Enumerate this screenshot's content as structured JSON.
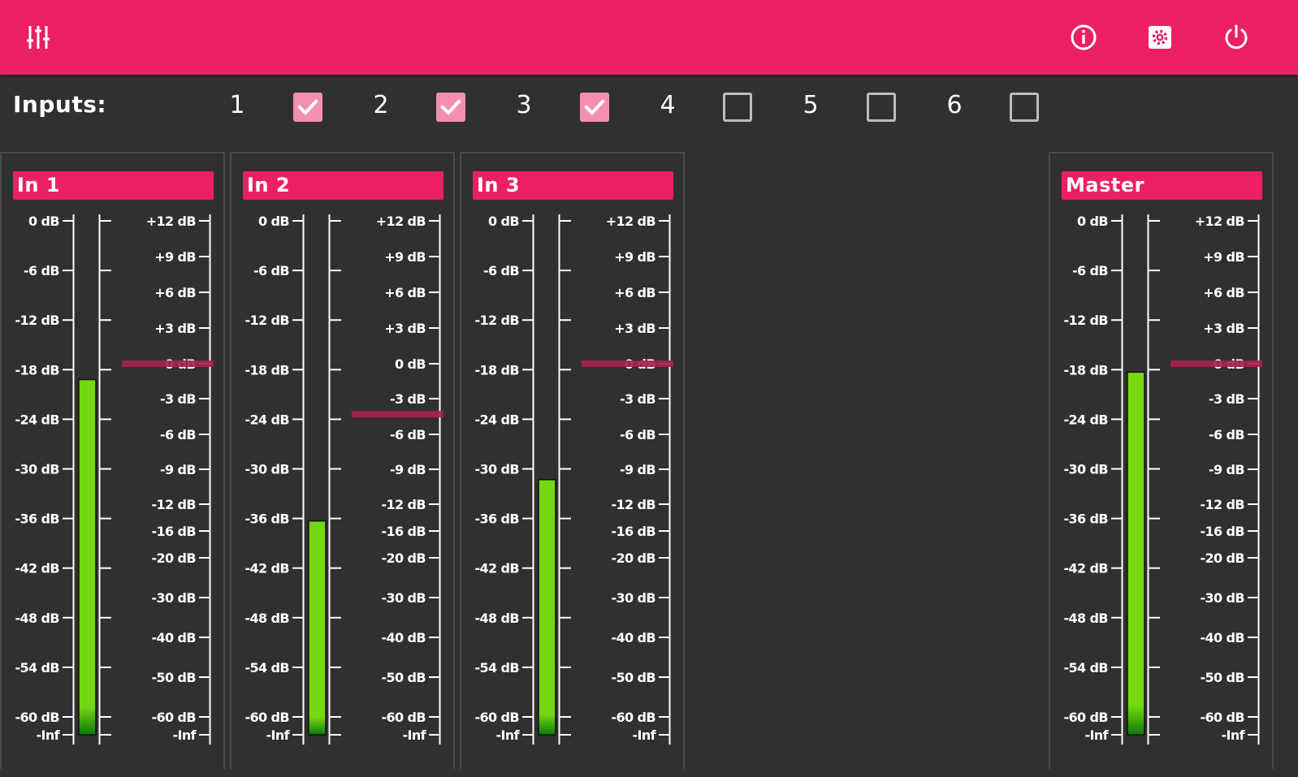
{
  "header": {
    "mixer_icon": "sliders-icon",
    "info_icon": "info-icon",
    "settings_icon": "settings-icon",
    "power_icon": "power-icon"
  },
  "inputs": {
    "label": "Inputs:",
    "items": [
      {
        "num": "1",
        "checked": true
      },
      {
        "num": "2",
        "checked": true
      },
      {
        "num": "3",
        "checked": true
      },
      {
        "num": "4",
        "checked": false
      },
      {
        "num": "5",
        "checked": false
      },
      {
        "num": "6",
        "checked": false
      }
    ]
  },
  "level_scale": [
    "0 dB",
    "-6 dB",
    "-12 dB",
    "-18 dB",
    "-24 dB",
    "-30 dB",
    "-36 dB",
    "-42 dB",
    "-48 dB",
    "-54 dB",
    "-60 dB",
    "-Inf"
  ],
  "gain_scale": [
    "+12 dB",
    "+9 dB",
    "+6 dB",
    "+3 dB",
    "0 dB",
    "-3 dB",
    "-6 dB",
    "-9 dB",
    "-12 dB",
    "-16 dB",
    "-20 dB",
    "-30 dB",
    "-40 dB",
    "-50 dB",
    "-60 dB",
    "-Inf"
  ],
  "colors": {
    "accent": "#ec1f65",
    "meter": "#76d810",
    "fader": "#a8224e",
    "background": "#303030"
  },
  "strips": [
    {
      "title": "In 1",
      "level_db": -19.2,
      "fader_db": 0
    },
    {
      "title": "In 2",
      "level_db": -36.3,
      "fader_db": -4.3
    },
    {
      "title": "In 3",
      "level_db": -31.3,
      "fader_db": 0
    },
    {
      "title": "Master",
      "level_db": -18.3,
      "fader_db": 0
    }
  ]
}
